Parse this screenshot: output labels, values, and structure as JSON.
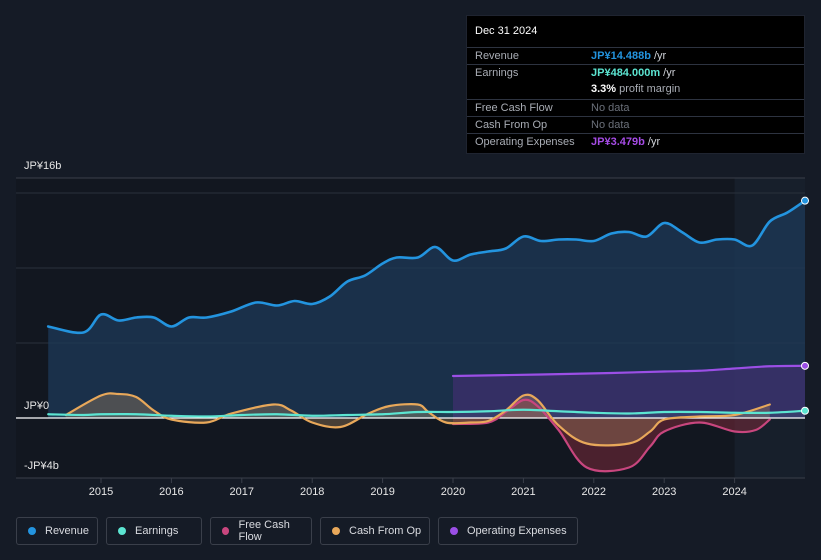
{
  "tooltip": {
    "date": "Dec 31 2024",
    "rows": [
      {
        "label": "Revenue",
        "value": "JP¥14.488b",
        "suffix": " /yr",
        "color": "#2394df"
      },
      {
        "label": "Earnings",
        "value": "JP¥484.000m",
        "suffix": " /yr",
        "color": "#5ce5d2"
      },
      {
        "label": "",
        "value": "3.3%",
        "suffix": " profit margin",
        "color": "#ffffff"
      },
      {
        "label": "Free Cash Flow",
        "value": "",
        "suffix": "No data",
        "color": "#a9adb5"
      },
      {
        "label": "Cash From Op",
        "value": "",
        "suffix": "No data",
        "color": "#a9adb5"
      },
      {
        "label": "Operating Expenses",
        "value": "JP¥3.479b",
        "suffix": " /yr",
        "color": "#a64ce6"
      }
    ]
  },
  "legend": [
    {
      "label": "Revenue",
      "color": "#2394df"
    },
    {
      "label": "Earnings",
      "color": "#5ce5d2"
    },
    {
      "label": "Free Cash Flow",
      "color": "#c8467e"
    },
    {
      "label": "Cash From Op",
      "color": "#e8a85a"
    },
    {
      "label": "Operating Expenses",
      "color": "#9b4fe6"
    }
  ],
  "chart_data": {
    "type": "area",
    "title": "",
    "xlabel": "",
    "ylabel": "",
    "unit": "JP¥ billions",
    "y_tick_labels": [
      "JP¥16b",
      "JP¥0",
      "-JP¥4b"
    ],
    "ylim": [
      -4,
      16
    ],
    "xlim": [
      2014,
      2025
    ],
    "x_ticks": [
      2015,
      2016,
      2017,
      2018,
      2019,
      2020,
      2021,
      2022,
      2023,
      2024
    ],
    "highlight_start": 2024,
    "grid": true,
    "legend_position": "bottom",
    "series": [
      {
        "name": "Revenue",
        "color": "#2394df",
        "x": [
          2014.25,
          2014.75,
          2015.0,
          2015.25,
          2015.5,
          2015.75,
          2016.0,
          2016.25,
          2016.5,
          2016.85,
          2017.2,
          2017.5,
          2017.75,
          2018.0,
          2018.25,
          2018.5,
          2018.75,
          2019.0,
          2019.2,
          2019.5,
          2019.75,
          2020.0,
          2020.25,
          2020.5,
          2020.75,
          2021.0,
          2021.25,
          2021.5,
          2021.75,
          2022.0,
          2022.25,
          2022.5,
          2022.75,
          2023.0,
          2023.25,
          2023.5,
          2023.75,
          2024.0,
          2024.25,
          2024.5,
          2024.75,
          2025.0
        ],
        "values": [
          6.1,
          5.7,
          6.9,
          6.5,
          6.7,
          6.7,
          6.1,
          6.7,
          6.7,
          7.1,
          7.7,
          7.5,
          7.8,
          7.6,
          8.1,
          9.1,
          9.5,
          10.3,
          10.7,
          10.7,
          11.4,
          10.5,
          10.9,
          11.1,
          11.3,
          12.1,
          11.8,
          11.9,
          11.9,
          11.8,
          12.3,
          12.4,
          12.1,
          13.0,
          12.4,
          11.7,
          11.9,
          11.9,
          11.5,
          13.1,
          13.7,
          14.488
        ]
      },
      {
        "name": "Earnings",
        "color": "#5ce5d2",
        "x": [
          2014.25,
          2014.75,
          2015.0,
          2015.5,
          2016.0,
          2016.5,
          2017.0,
          2017.5,
          2018.0,
          2018.5,
          2019.0,
          2019.5,
          2020.0,
          2020.5,
          2021.0,
          2021.5,
          2022.0,
          2022.5,
          2023.0,
          2023.5,
          2024.0,
          2024.5,
          2025.0
        ],
        "values": [
          0.25,
          0.2,
          0.25,
          0.25,
          0.15,
          0.1,
          0.2,
          0.25,
          0.15,
          0.2,
          0.25,
          0.4,
          0.4,
          0.45,
          0.55,
          0.45,
          0.35,
          0.3,
          0.4,
          0.4,
          0.35,
          0.35,
          0.484
        ]
      },
      {
        "name": "Free Cash Flow",
        "color": "#c8467e",
        "x": [
          2020.0,
          2020.5,
          2020.75,
          2021.0,
          2021.2,
          2021.5,
          2021.9,
          2022.5,
          2022.8,
          2023.0,
          2023.5,
          2024.0,
          2024.3,
          2024.5
        ],
        "values": [
          -0.4,
          -0.3,
          0.4,
          1.2,
          0.8,
          -0.8,
          -3.3,
          -3.3,
          -1.9,
          -0.9,
          -0.3,
          -0.9,
          -0.8,
          -0.1
        ]
      },
      {
        "name": "Cash From Op",
        "color": "#e8a85a",
        "x": [
          2014.5,
          2015.0,
          2015.25,
          2015.5,
          2015.75,
          2016.0,
          2016.5,
          2016.85,
          2017.45,
          2017.7,
          2018.0,
          2018.4,
          2018.8,
          2019.1,
          2019.5,
          2019.65,
          2019.9,
          2020.25,
          2020.5,
          2020.75,
          2021.0,
          2021.2,
          2021.5,
          2021.9,
          2022.5,
          2022.8,
          2023.0,
          2023.5,
          2024.0,
          2024.5
        ],
        "values": [
          0.2,
          1.5,
          1.6,
          1.4,
          0.5,
          -0.1,
          -0.3,
          0.3,
          0.9,
          0.5,
          -0.3,
          -0.6,
          0.3,
          0.8,
          0.9,
          0.4,
          -0.3,
          -0.3,
          -0.2,
          0.5,
          1.5,
          1.2,
          -0.5,
          -1.7,
          -1.7,
          -0.9,
          -0.1,
          0.1,
          0.2,
          0.9
        ]
      },
      {
        "name": "Operating Expenses",
        "color": "#9b4fe6",
        "x": [
          2020.0,
          2021.25,
          2022.25,
          2023.0,
          2023.5,
          2024.0,
          2024.5,
          2025.0
        ],
        "values": [
          2.8,
          2.9,
          3.0,
          3.1,
          3.15,
          3.3,
          3.45,
          3.479
        ]
      }
    ]
  }
}
